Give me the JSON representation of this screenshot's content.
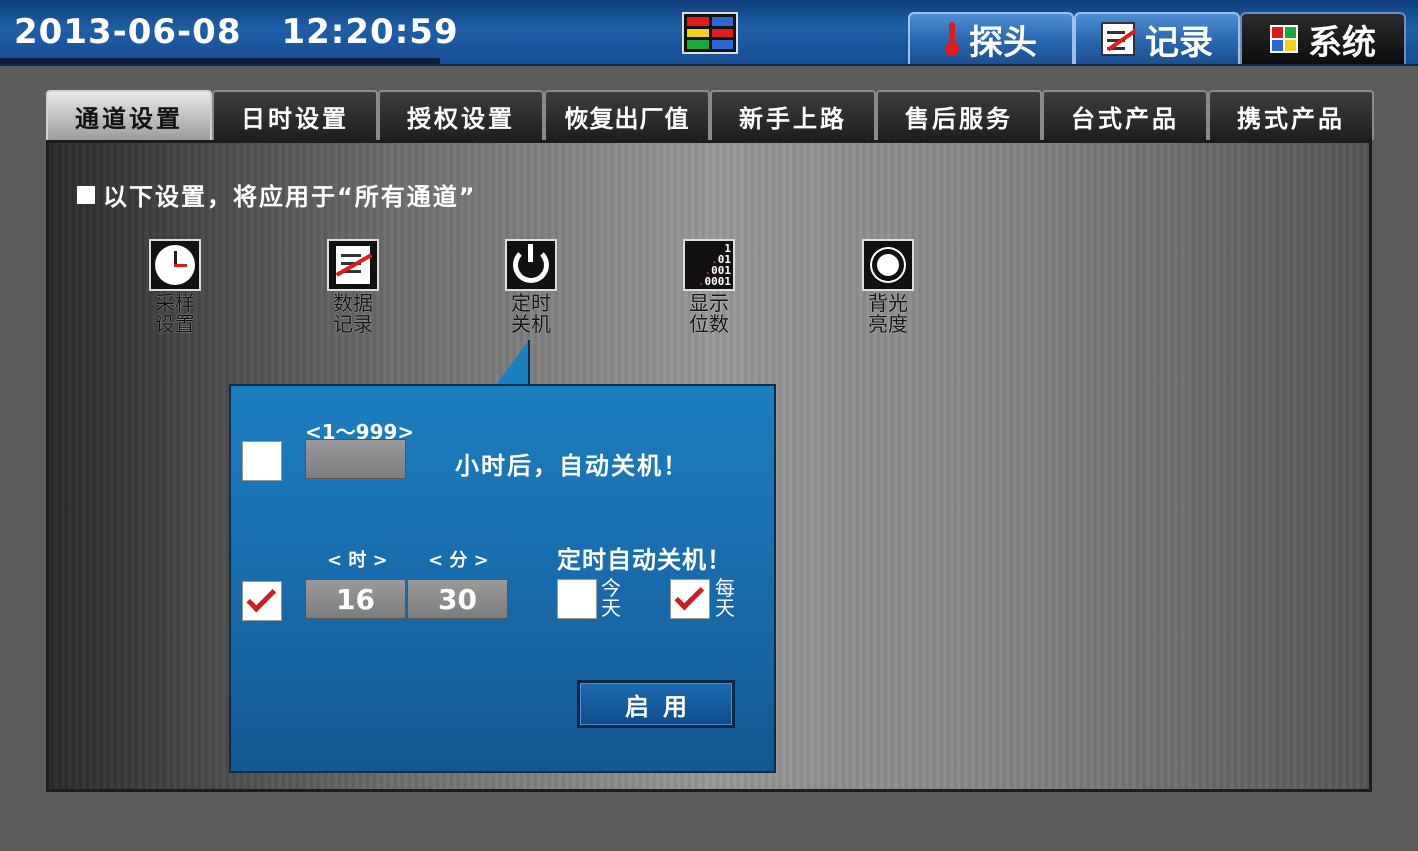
{
  "header": {
    "date": "2013-06-08",
    "time": "12:20:59",
    "tabs": [
      {
        "label": "探头",
        "icon": "thermometer-icon",
        "active": false
      },
      {
        "label": "记录",
        "icon": "record-icon",
        "active": false
      },
      {
        "label": "系统",
        "icon": "system-icon",
        "active": true
      }
    ]
  },
  "sub_tabs": [
    {
      "label": "通道设置",
      "active": true
    },
    {
      "label": "日时设置",
      "active": false
    },
    {
      "label": "授权设置",
      "active": false
    },
    {
      "label": "恢复出厂值",
      "active": false
    },
    {
      "label": "新手上路",
      "active": false
    },
    {
      "label": "售后服务",
      "active": false
    },
    {
      "label": "台式产品",
      "active": false
    },
    {
      "label": "携式产品",
      "active": false
    }
  ],
  "panel": {
    "note": "以下设置，将应用于“所有通道”",
    "functions": [
      {
        "label_line1": "采样",
        "label_line2": "设置",
        "icon": "clock-icon"
      },
      {
        "label_line1": "数据",
        "label_line2": "记录",
        "icon": "data-record-icon"
      },
      {
        "label_line1": "定时",
        "label_line2": "关机",
        "icon": "power-icon"
      },
      {
        "label_line1": "显示",
        "label_line2": "位数",
        "icon": "digits-icon"
      },
      {
        "label_line1": "背光",
        "label_line2": "亮度",
        "icon": "brightness-icon"
      }
    ]
  },
  "popup": {
    "hours_range": "<1～999>",
    "hours_value": "",
    "hours_checked": false,
    "hours_text": "小时后，自动关机！",
    "hour_label": "< 时 >",
    "minute_label": "< 分 >",
    "hour_value": "16",
    "minute_value": "30",
    "timed_checked": true,
    "timed_text": "定时自动关机！",
    "today_line1": "今",
    "today_line2": "天",
    "today_checked": false,
    "everyday_line1": "每",
    "everyday_line2": "天",
    "everyday_checked": true,
    "apply_label": "启用"
  },
  "colors": {
    "accent_blue": "#1c7fc0",
    "check_red": "#d01e1e"
  }
}
